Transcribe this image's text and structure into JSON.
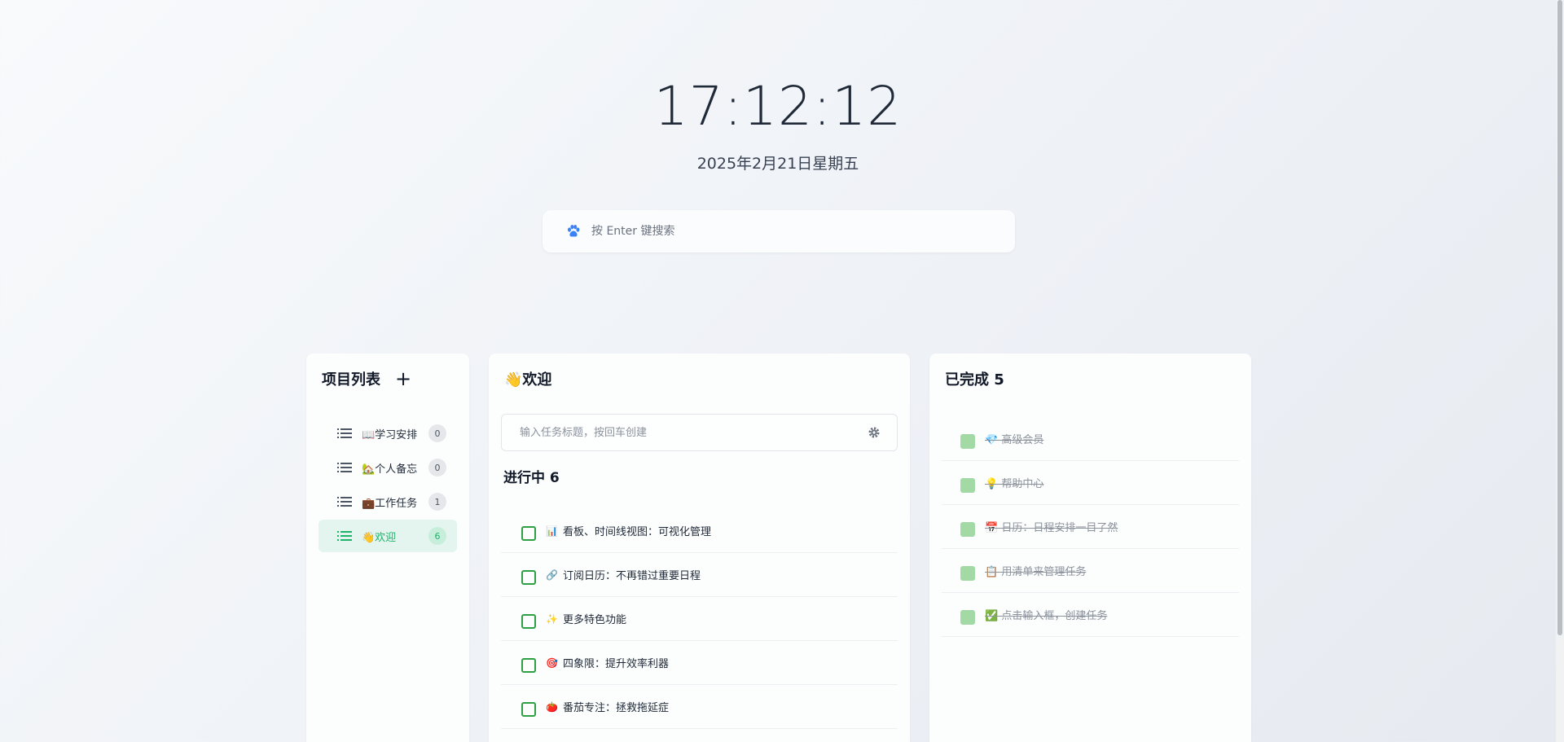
{
  "clock": {
    "time": "17:12:12",
    "date": "2025年2月21日星期五"
  },
  "search": {
    "placeholder": "按 Enter 键搜索",
    "icon": "paw-icon"
  },
  "projects": {
    "title": "项目列表",
    "add_label": "+",
    "items": [
      {
        "label": "📖学习安排",
        "count": "0",
        "active": false
      },
      {
        "label": "🏡个人备忘",
        "count": "0",
        "active": false
      },
      {
        "label": "💼工作任务",
        "count": "1",
        "active": true
      },
      {
        "label": "👋欢迎",
        "count": "6",
        "active": true
      }
    ]
  },
  "main": {
    "title": "👋欢迎",
    "input_placeholder": "输入任务标题，按回车创建",
    "section_title": "进行中  6",
    "tasks": [
      {
        "emoji": "📊",
        "label": "看板、时间线视图：可视化管理"
      },
      {
        "emoji": "🔗",
        "label": "订阅日历：不再错过重要日程"
      },
      {
        "emoji": "✨",
        "label": "更多特色功能"
      },
      {
        "emoji": "🎯",
        "label": "四象限：提升效率利器"
      },
      {
        "emoji": "🍅",
        "label": "番茄专注：拯救拖延症"
      }
    ]
  },
  "done": {
    "title": "已完成 5",
    "items": [
      {
        "label": "💎 高级会员"
      },
      {
        "label": "💡 帮助中心"
      },
      {
        "label": "📅 日历：日程安排一目了然"
      },
      {
        "label": "📋 用清单来管理任务"
      },
      {
        "label": "✅ 点击输入框，创建任务"
      }
    ]
  },
  "colors": {
    "accent": "#1eb36a",
    "checkbox": "#2ea043",
    "done_check": "#a3d9a5",
    "search_icon": "#3b82f6"
  }
}
